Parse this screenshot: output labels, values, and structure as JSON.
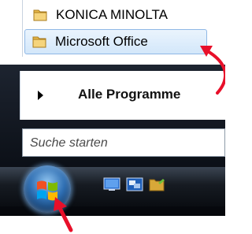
{
  "program_list": {
    "items": [
      {
        "label": "KONICA MINOLTA",
        "icon": "folder-icon",
        "highlighted": false
      },
      {
        "label": "Microsoft Office",
        "icon": "folder-icon",
        "highlighted": true
      }
    ]
  },
  "all_programs": {
    "label": "Alle Programme",
    "icon": "arrow-right-icon"
  },
  "search": {
    "placeholder": "Suche starten"
  },
  "taskbar": {
    "start_icon": "windows-logo-icon",
    "quick_launch": [
      {
        "icon": "show-desktop-icon"
      },
      {
        "icon": "switch-windows-icon"
      },
      {
        "icon": "folder-icon"
      }
    ]
  },
  "colors": {
    "highlight_bg": "#d3e7fa",
    "highlight_border": "#8fb8e6",
    "annotation_arrow": "#e8102a",
    "taskbar": "#161b22"
  }
}
